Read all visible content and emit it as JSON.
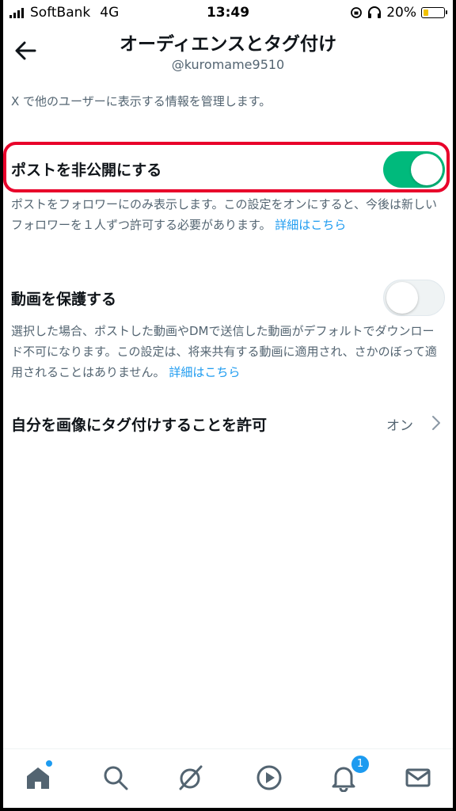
{
  "status": {
    "carrier": "SoftBank",
    "network": "4G",
    "time": "13:49",
    "battery": "20%",
    "battery_level": 0.2
  },
  "header": {
    "title": "オーディエンスとタグ付け",
    "handle": "@kuromame9510"
  },
  "description": "X で他のユーザーに表示する情報を管理します。",
  "protect_posts": {
    "label": "ポストを非公開にする",
    "enabled": true,
    "help": "ポストをフォロワーにのみ表示します。この設定をオンにすると、今後は新しいフォロワーを１人ずつ許可する必要があります。",
    "link": "詳細はこちら"
  },
  "protect_videos": {
    "label": "動画を保護する",
    "enabled": false,
    "help": "選択した場合、ポストした動画やDMで送信した動画がデフォルトでダウンロード不可になります。この設定は、将来共有する動画に適用され、さかのぼって適用されることはありません。",
    "link": "詳細はこちら"
  },
  "photo_tagging": {
    "label": "自分を画像にタグ付けすることを許可",
    "value": "オン"
  },
  "tabbar": {
    "notifications_badge": "1",
    "accent": "#1d9bf0"
  },
  "colors": {
    "toggle_on": "#00ba7c",
    "highlight": "#e8002a",
    "link": "#1d9bf0"
  }
}
